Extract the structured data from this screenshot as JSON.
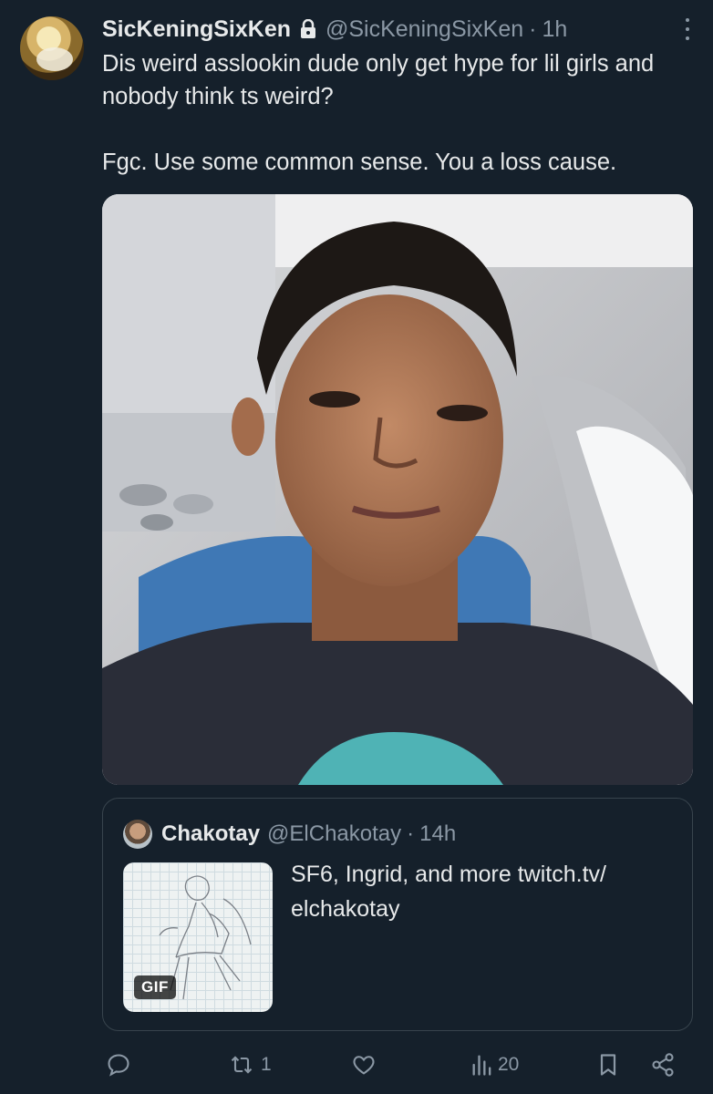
{
  "tweet": {
    "display_name": "SicKeningSixKen",
    "handle": "@SicKeningSixKen",
    "separator": "·",
    "time": "1h",
    "text": "Dis weird asslookin dude only get hype for lil girls and nobody think ts weird?\n\nFgc. Use some common sense. You a loss cause."
  },
  "quote": {
    "display_name": "Chakotay",
    "handle": "@ElChakotay",
    "separator": "·",
    "time": "14h",
    "text": "SF6, Ingrid, and more twitch.tv/\nelchakotay",
    "media_badge": "GIF"
  },
  "actions": {
    "reply_count": "",
    "retweet_count": "1",
    "like_count": "",
    "views_count": "20"
  },
  "icons": [
    "lock-icon",
    "more-icon",
    "reply-icon",
    "retweet-icon",
    "like-icon",
    "views-icon",
    "bookmark-icon",
    "share-icon"
  ],
  "colors": {
    "background": "#15202b",
    "text": "#e7e9ea",
    "secondary": "#8b98a5",
    "border": "#38444d"
  }
}
